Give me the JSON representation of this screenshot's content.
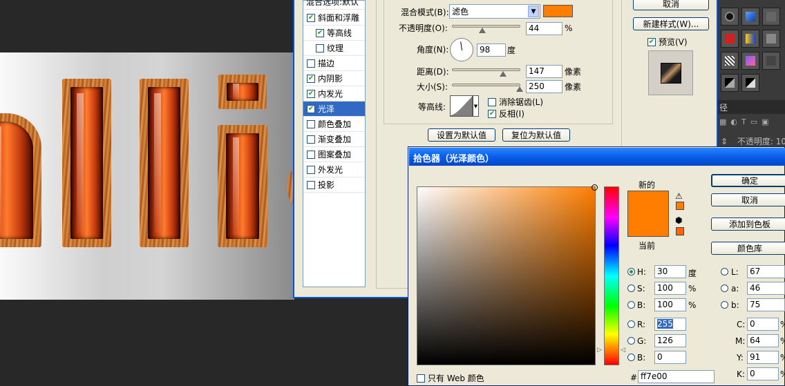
{
  "canvas": {
    "partial_letters": "hlli"
  },
  "layer_style": {
    "title_partial": "混合选项:默认",
    "items": [
      {
        "label": "斜面和浮雕",
        "checked": true
      },
      {
        "label": "等高线",
        "checked": true
      },
      {
        "label": "纹理",
        "checked": false
      },
      {
        "label": "描边",
        "checked": false
      },
      {
        "label": "内阴影",
        "checked": true
      },
      {
        "label": "内发光",
        "checked": true
      },
      {
        "label": "光泽",
        "checked": true,
        "selected": true
      },
      {
        "label": "颜色叠加",
        "checked": false
      },
      {
        "label": "渐变叠加",
        "checked": false
      },
      {
        "label": "图案叠加",
        "checked": false
      },
      {
        "label": "外发光",
        "checked": false
      },
      {
        "label": "投影",
        "checked": false
      }
    ],
    "blend_mode_label": "混合模式(B):",
    "blend_mode_value": "滤色",
    "blend_color": "#ff7e00",
    "opacity_label": "不透明度(O):",
    "opacity_value": "44",
    "opacity_unit": "%",
    "angle_label": "角度(N):",
    "angle_value": "98",
    "angle_unit": "度",
    "distance_label": "距离(D):",
    "distance_value": "147",
    "distance_unit": "像素",
    "size_label": "大小(S):",
    "size_value": "250",
    "size_unit": "像素",
    "contour_label": "等高线:",
    "antialias_label": "消除锯齿(L)",
    "antialias_checked": false,
    "invert_label": "反相(I)",
    "invert_checked": true,
    "set_default_button": "设置为默认值",
    "reset_default_button": "复位为默认值",
    "cancel_button": "取消",
    "new_style_button": "新建样式(W)...",
    "preview_label": "预览(V)",
    "preview_checked": true
  },
  "right_panel": {
    "header_char": "径",
    "opacity_label": "不透明度: 10"
  },
  "color_picker": {
    "title": "拾色器（光泽颜色）",
    "new_label": "新的",
    "current_label": "当前",
    "new_color": "#ff7e00",
    "current_color": "#ff7e00",
    "ok_button": "确定",
    "cancel_button": "取消",
    "add_swatch_button": "添加到色板",
    "library_button": "颜色库",
    "h_label": "H:",
    "h_value": "30",
    "h_unit": "度",
    "s_label": "S:",
    "s_value": "100",
    "s_unit": "%",
    "b_label": "B:",
    "b_value": "100",
    "b_unit": "%",
    "r_label": "R:",
    "r_value": "255",
    "g_label": "G:",
    "g_value": "126",
    "b2_label": "B:",
    "b2_value": "0",
    "l_label": "L:",
    "l_value": "67",
    "a_label": "a:",
    "a_value": "46",
    "lab_b_label": "b:",
    "lab_b_value": "75",
    "c_label": "C:",
    "c_value": "0",
    "c_unit": "%",
    "m_label": "M:",
    "m_value": "64",
    "m_unit": "%",
    "y_label": "Y:",
    "y_value": "91",
    "y_unit": "%",
    "k_label": "K:",
    "k_value": "0",
    "k_unit": "%",
    "hex_label": "#",
    "hex_value": "ff7e00",
    "web_only_label": "只有 Web 颜色",
    "web_only_checked": false
  }
}
